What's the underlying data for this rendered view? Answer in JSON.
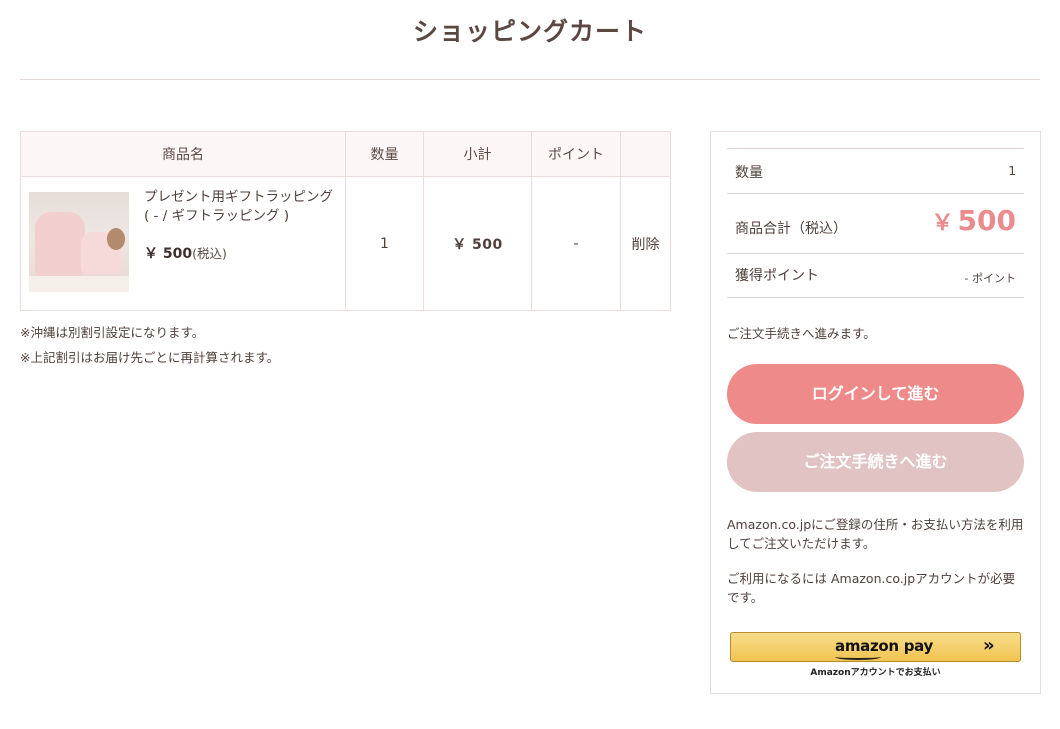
{
  "page": {
    "title": "ショッピングカート"
  },
  "cart": {
    "headers": {
      "product": "商品名",
      "quantity": "数量",
      "subtotal": "小計",
      "points": "ポイント",
      "action": ""
    },
    "items": [
      {
        "name": "プレゼント用ギフトラッピング",
        "variant": "( - / ギフトラッピング )",
        "price": "￥ 500",
        "tax_label": "(税込)",
        "quantity": "1",
        "subtotal": "￥ 500",
        "points": "-",
        "delete_label": "削除"
      }
    ],
    "notes": [
      "※沖縄は別割引設定になります。",
      "※上記割引はお届け先ごとに再計算されます。"
    ]
  },
  "summary": {
    "quantity_label": "数量",
    "quantity_value": "1",
    "total_label": "商品合計（税込）",
    "total_yen": "￥",
    "total_value": "500",
    "points_label": "獲得ポイント",
    "points_value": "- ポイント",
    "proceed_text": "ご注文手続きへ進みます。",
    "login_button": "ログインして進む",
    "order_button": "ご注文手続きへ進む",
    "amazon_text_1": "Amazon.co.jpにご登録の住所・お支払い方法を利用してご注文いただけます。",
    "amazon_text_2": "ご利用になるには Amazon.co.jpアカウントが必要です。",
    "amazon_pay_label": "amazon pay",
    "amazon_pay_chevron": "»",
    "amazon_caption": "Amazonアカウントでお支払い"
  },
  "colors": {
    "accent": "#ee8a89",
    "accent_light": "#e1c3c3",
    "text": "#4f3f3a",
    "amazon_gold": "#f1c451"
  }
}
